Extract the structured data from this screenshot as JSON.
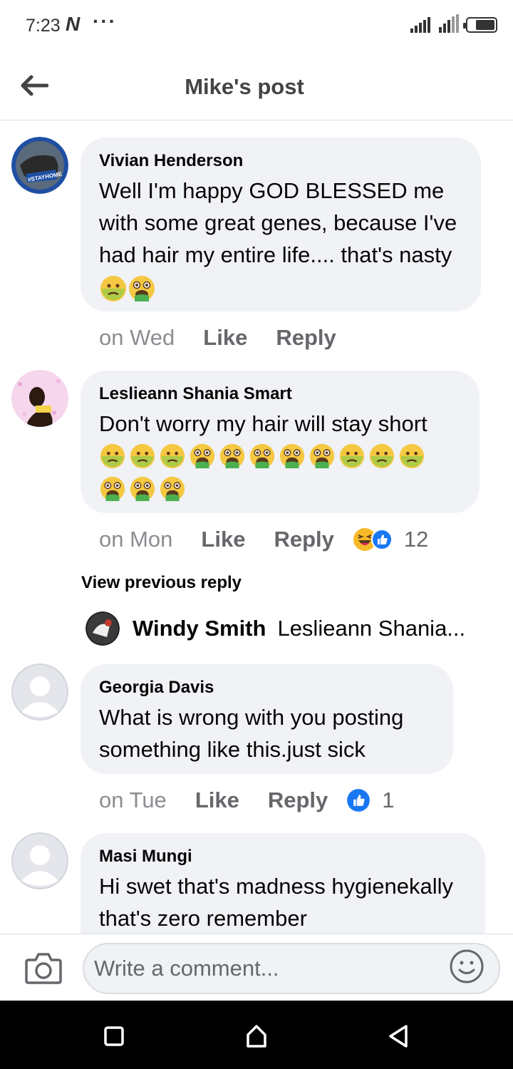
{
  "status": {
    "time": "7:23",
    "n_badge": "N",
    "dots": "···"
  },
  "header": {
    "title": "Mike's post"
  },
  "comments": [
    {
      "author": "Vivian Henderson",
      "text": "Well I'm happy GOD BLESSED me with some great genes, because I've had hair my entire life.... that's nasty",
      "emojis": [
        "nauseated-face",
        "vomiting-face"
      ],
      "time": "on Wed",
      "like": "Like",
      "reply": "Reply",
      "avatar_badge": "#STAYHOME"
    },
    {
      "author": "Leslieann Shania Smart",
      "text": "Don't worry my hair will stay short",
      "emojis": [
        "nauseated-face",
        "nauseated-face",
        "nauseated-face",
        "vomiting-face",
        "vomiting-face",
        "vomiting-face",
        "vomiting-face",
        "vomiting-face",
        "nauseated-face",
        "nauseated-face",
        "nauseated-face",
        "vomiting-face",
        "vomiting-face",
        "vomiting-face"
      ],
      "time": "on Mon",
      "like": "Like",
      "reply": "Reply",
      "reactions": [
        "haha-icon",
        "like-icon"
      ],
      "reaction_count": "12"
    },
    {
      "author": "Georgia Davis",
      "text": "What is wrong with you posting something like this.just sick",
      "time": "on Tue",
      "like": "Like",
      "reply": "Reply",
      "reactions": [
        "like-icon"
      ],
      "reaction_count": "1"
    },
    {
      "author": "Masi Mungi",
      "text": "Hi swet that's madness hygienekally that's zero remember"
    }
  ],
  "view_previous": "View previous reply",
  "reply_preview": {
    "author": "Windy Smith",
    "snippet": "Leslieann Shania..."
  },
  "composer": {
    "placeholder": "Write a comment..."
  },
  "colors": {
    "bubble": "#f0f2f5",
    "like_blue": "#1877f2",
    "muted": "#65676b"
  }
}
